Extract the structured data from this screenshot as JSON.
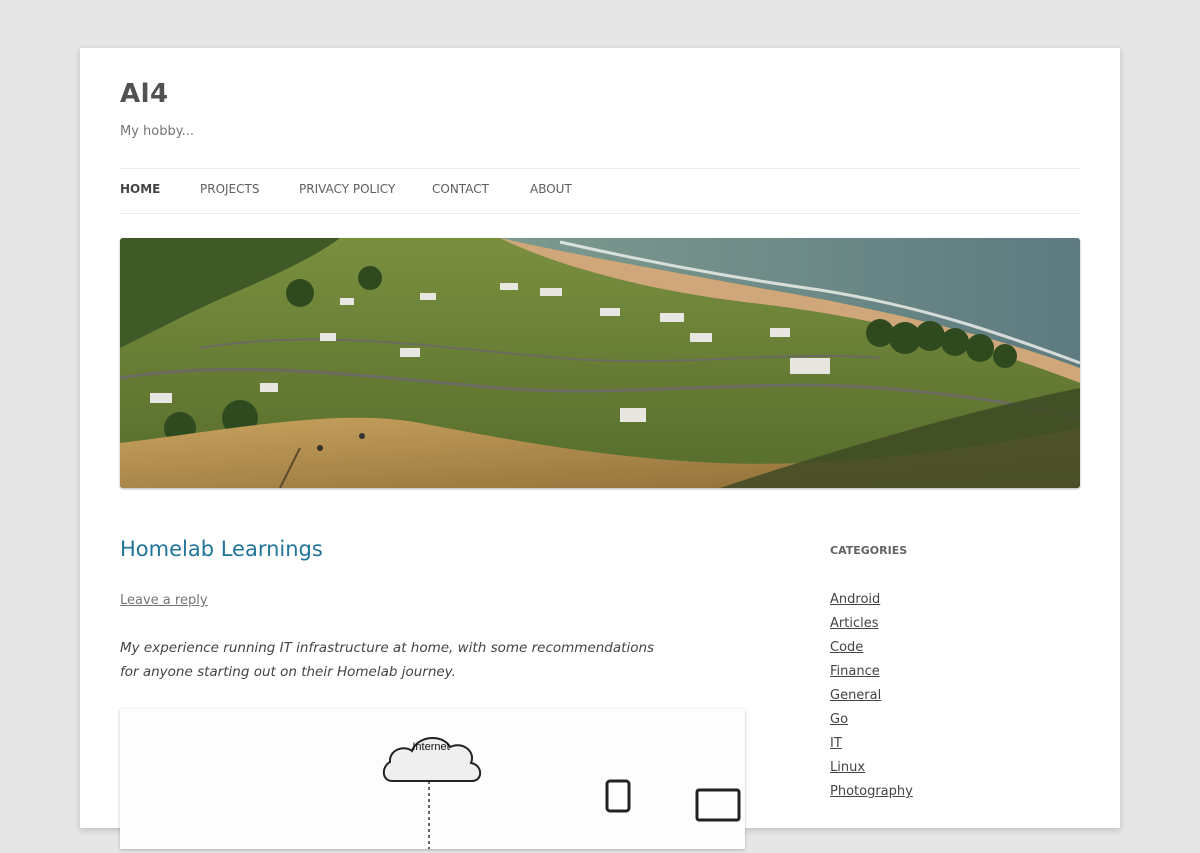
{
  "site": {
    "title": "Al4",
    "description": "My hobby..."
  },
  "nav": {
    "items": [
      {
        "label": "HOME",
        "current": true
      },
      {
        "label": "PROJECTS",
        "current": false
      },
      {
        "label": "PRIVACY POLICY",
        "current": false
      },
      {
        "label": "CONTACT",
        "current": false
      },
      {
        "label": "ABOUT",
        "current": false
      }
    ]
  },
  "header_image": {
    "description_icon": "coastal-landscape-image",
    "colors": {
      "sea": "#6b8a86",
      "sand": "#c9a27a",
      "grass": "#6e8a3c",
      "hill": "#b48a4a"
    }
  },
  "post": {
    "title": "Homelab Learnings",
    "leave_reply": "Leave a reply",
    "excerpt": "My experience running IT infrastructure at home, with some recommendations for anyone starting out on their Homelab journey.",
    "diagram": {
      "cloud_label": "Internet"
    }
  },
  "sidebar": {
    "categories_title": "CATEGORIES",
    "categories": [
      "Android",
      "Articles",
      "Code",
      "Finance",
      "General",
      "Go",
      "IT",
      "Linux",
      "Photography"
    ]
  },
  "colors": {
    "background": "#e6e6e6",
    "link_blue": "#21759b",
    "text": "#444444"
  }
}
